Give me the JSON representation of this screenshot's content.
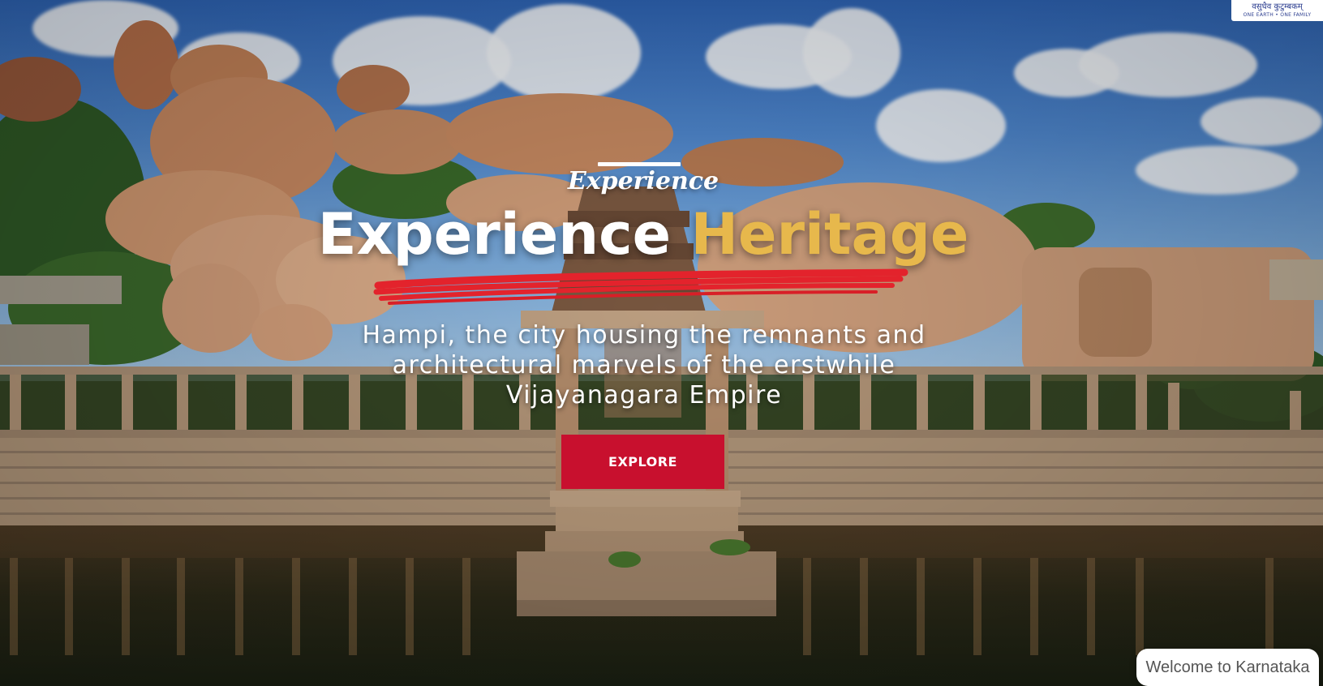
{
  "logo": {
    "line1": "वसुधैव कुटुम्बकम्",
    "line2": "ONE EARTH • ONE FAMILY",
    "icon": "g20-emblem-icon"
  },
  "hero": {
    "eyebrow": "Experience",
    "headline_white": "Experience",
    "headline_gold": "Heritage",
    "tagline": "Hampi, the city housing the remnants and architectural marvels of the erstwhile Vijayanagara Empire",
    "cta_label": "EXPLORE"
  },
  "chat": {
    "greeting": "Welcome to Karnataka"
  },
  "colors": {
    "accent_gold": "#e7b84c",
    "brand_red": "#c8102e",
    "brush_red": "#e3232c"
  }
}
